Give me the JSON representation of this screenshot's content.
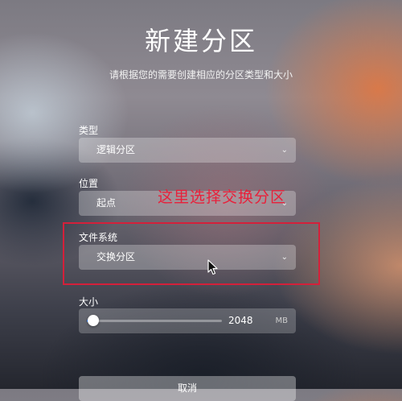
{
  "dialog": {
    "title": "新建分区",
    "subtitle": "请根据您的需要创建相应的分区类型和大小"
  },
  "fields": {
    "type": {
      "label": "类型",
      "value": "逻辑分区"
    },
    "location": {
      "label": "位置",
      "value": "起点"
    },
    "filesystem": {
      "label": "文件系统",
      "value": "交换分区"
    },
    "size": {
      "label": "大小",
      "value": "2048",
      "unit": "MB",
      "slider_fraction": 0.05
    }
  },
  "annotation": {
    "text": "这里选择交换分区",
    "color": "#e8203a"
  },
  "buttons": {
    "cancel": "取消"
  },
  "colors": {
    "accent": "#2f7cf6",
    "highlight": "#d4203a"
  },
  "icons": {
    "dropdown": "chevron-down-icon",
    "cursor": "mouse-pointer-icon"
  }
}
